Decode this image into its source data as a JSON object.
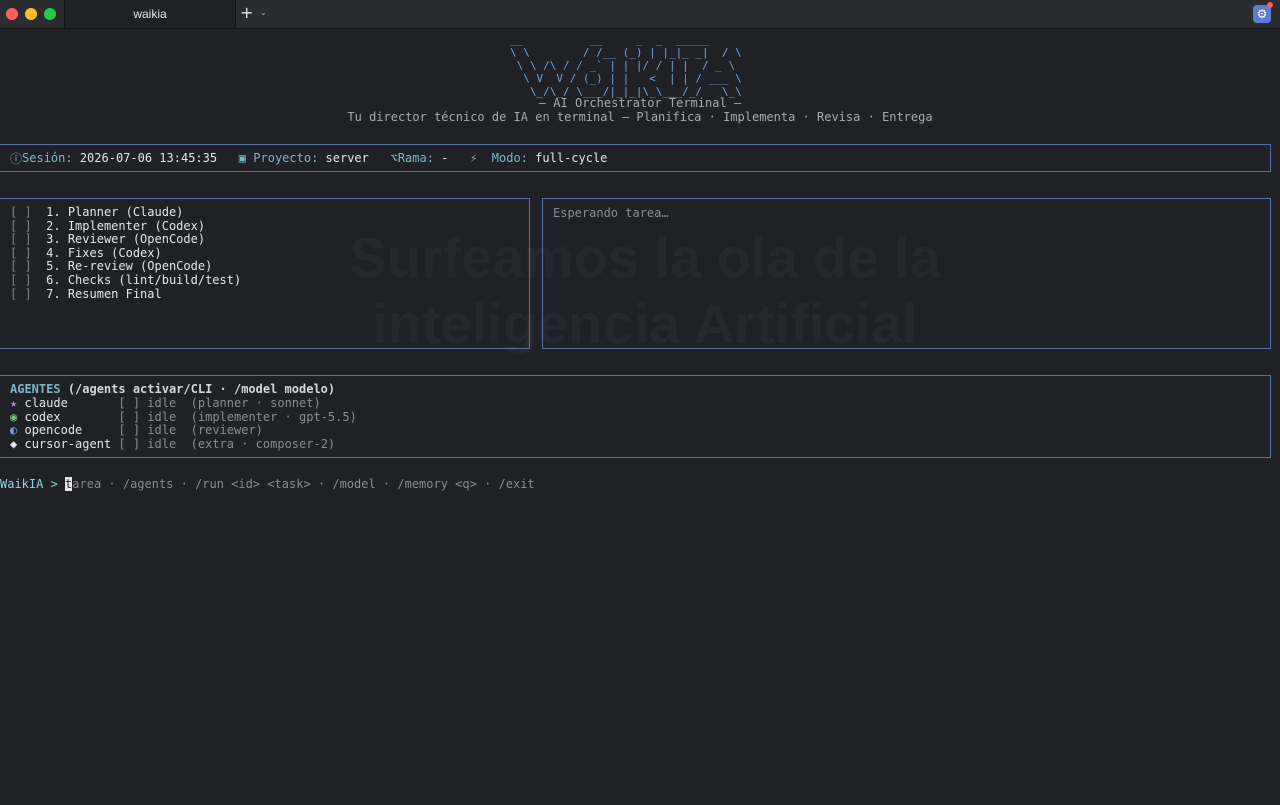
{
  "window": {
    "tab_title": "waikia",
    "new_tab_glyph": "+",
    "tab_menu_glyph": "⌄",
    "settings_glyph": "⚙"
  },
  "background_ghost": {
    "line1": "Surfeamos la ola de la",
    "line2": "inteligencia Artificial"
  },
  "logo": {
    "ascii": "__          __     _  _  _____          \n\\ \\        / /__ (_) | |_|_ _|  / \\  \n \\ \\ /\\ / / _` | | |/ / | |  / _ \\ \n  \\ V  V / (_) | |   <  | | / ___ \\\n   \\_/\\_/ \\___/|_|_|\\_\\___/_/   \\_\\"
  },
  "header": {
    "tagline": "— AI Orchestrator Terminal —",
    "description": "Tu director técnico de IA en terminal — Planifica · Implementa · Revisa · Entrega"
  },
  "session": {
    "session_icon": "ⓘ",
    "session_label": "Sesión:",
    "session_value": "2026-07-06 13:45:35",
    "project_icon": "▣",
    "project_label": "Proyecto:",
    "project_value": "server",
    "branch_icon": "⌥",
    "branch_label": "Rama:",
    "branch_value": "-",
    "mode_icon": "⚡",
    "mode_label": "Modo:",
    "mode_value": "full-cycle"
  },
  "steps": [
    {
      "box": "[ ]",
      "label": "1. Planner (Claude)"
    },
    {
      "box": "[ ]",
      "label": "2. Implementer (Codex)"
    },
    {
      "box": "[ ]",
      "label": "3. Reviewer (OpenCode)"
    },
    {
      "box": "[ ]",
      "label": "4. Fixes (Codex)"
    },
    {
      "box": "[ ]",
      "label": "5. Re-review (OpenCode)"
    },
    {
      "box": "[ ]",
      "label": "6. Checks (lint/build/test)"
    },
    {
      "box": "[ ]",
      "label": "7. Resumen Final"
    }
  ],
  "output": {
    "waiting": "Esperando tarea…"
  },
  "agents": {
    "title": "AGENTES",
    "hint": "(/agents activar/CLI · /model modelo)",
    "list": [
      {
        "icon": "★",
        "icon_color": "#b779d8",
        "name": "claude",
        "status": "[ ] idle",
        "detail": "(planner · sonnet)"
      },
      {
        "icon": "◉",
        "icon_color": "#7fbf7f",
        "name": "codex",
        "status": "[ ] idle",
        "detail": "(implementer · gpt-5.5)"
      },
      {
        "icon": "◐",
        "icon_color": "#6f9fe0",
        "name": "opencode",
        "status": "[ ] idle",
        "detail": "(reviewer)"
      },
      {
        "icon": "◆",
        "icon_color": "#e3e5e8",
        "name": "cursor-agent",
        "status": "[ ] idle",
        "detail": "(extra · composer-2)"
      }
    ]
  },
  "prompt": {
    "label": "WaikIA > ",
    "cursor_char": "t",
    "placeholder_rest": "area · /agents · /run <id> <task> · /model · /memory <q> · /exit"
  },
  "colors": {
    "accent_cyan": "#7cb7c6",
    "border_blue": "#5470a6",
    "logo_blue": "#6fa3df"
  }
}
